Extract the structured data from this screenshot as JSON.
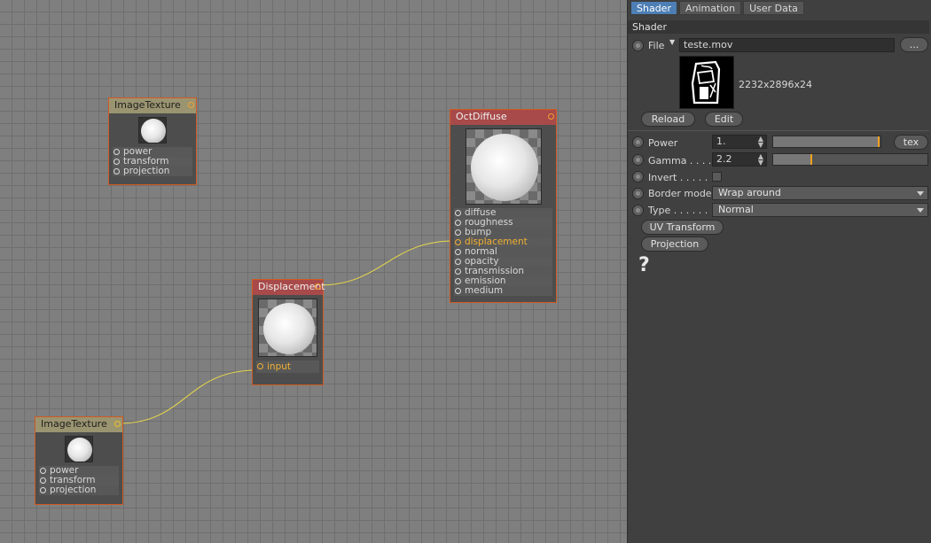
{
  "graph": {
    "nodes": {
      "image_texture_top": {
        "title": "ImageTexture",
        "ports": [
          "power",
          "transform",
          "projection"
        ]
      },
      "image_texture_bottom": {
        "title": "ImageTexture",
        "ports": [
          "power",
          "transform",
          "projection"
        ]
      },
      "displacement": {
        "title": "Displacement",
        "ports": [
          "input"
        ]
      },
      "oct_diffuse": {
        "title": "OctDiffuse",
        "ports": [
          "diffuse",
          "roughness",
          "bump",
          "displacement",
          "normal",
          "opacity",
          "transmission",
          "emission",
          "medium"
        ]
      }
    },
    "wire_color": "#e8d84a"
  },
  "panel": {
    "tabs": [
      "Shader",
      "Animation",
      "User Data"
    ],
    "section_title": "Shader",
    "file": {
      "label": "File",
      "value": "teste.mov",
      "browse_label": "..."
    },
    "preview": {
      "info": "2232x2896x24"
    },
    "reload_label": "Reload",
    "edit_label": "Edit",
    "power": {
      "label": "Power",
      "value": "1.",
      "slider_fraction": 0.99,
      "tex_label": "tex"
    },
    "gamma": {
      "label": "Gamma . . . . .",
      "value": "2.2",
      "slider_fraction": 0.25
    },
    "invert": {
      "label": "Invert . . . . . .",
      "checked": false
    },
    "border_mode": {
      "label": "Border mode",
      "value": "Wrap around"
    },
    "type": {
      "label": "Type . . . . . . .",
      "value": "Normal"
    },
    "uv_transform_label": "UV Transform",
    "projection_label": "Projection",
    "help_label": "?"
  },
  "colors": {
    "accent": "#f0a020",
    "tab_active": "#4d7fb5",
    "node_border": "#d05a22"
  }
}
